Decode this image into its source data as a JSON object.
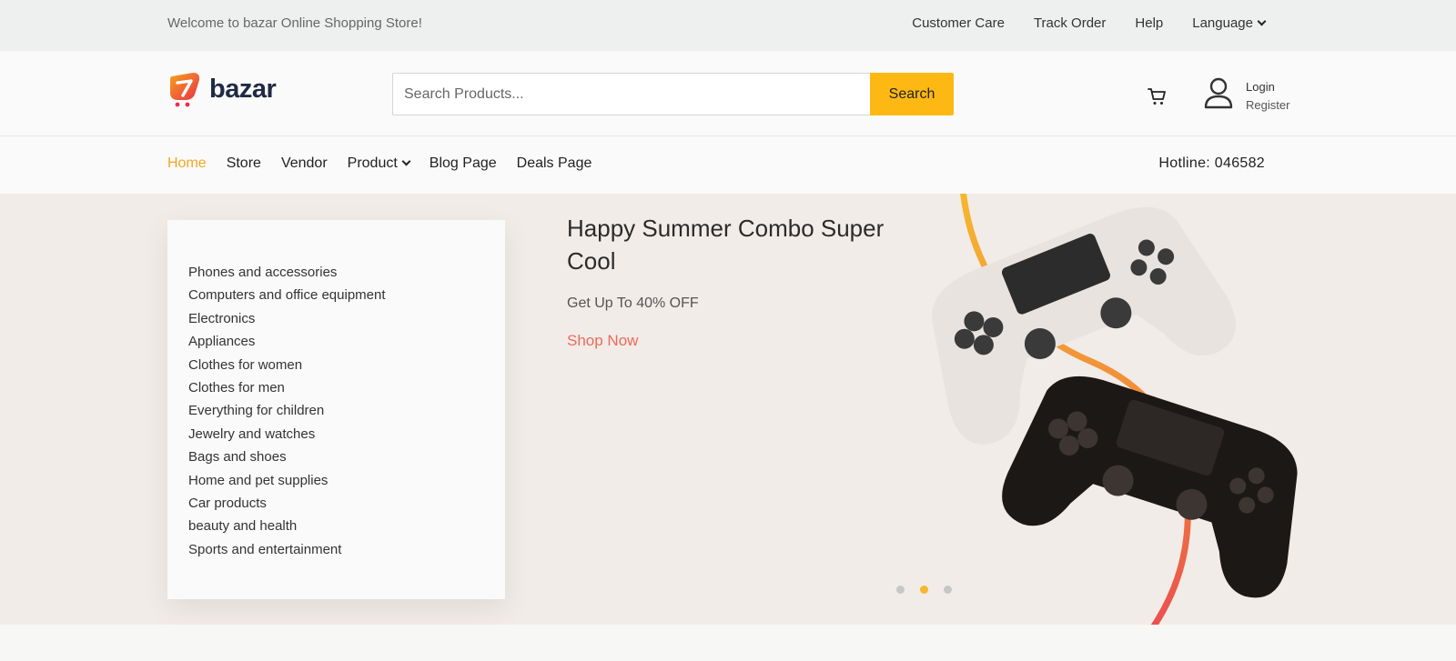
{
  "topbar": {
    "welcome": "Welcome to bazar Online Shopping Store!",
    "links": [
      "Customer Care",
      "Track Order",
      "Help"
    ],
    "language": "Language"
  },
  "header": {
    "logo_text": "bazar",
    "search_placeholder": "Search Products...",
    "search_button": "Search",
    "login": "Login",
    "register": "Register"
  },
  "nav": {
    "items": [
      "Home",
      "Store",
      "Vendor",
      "Product",
      "Blog Page",
      "Deals Page"
    ],
    "active": "Home",
    "hotline": "Hotline: 046582"
  },
  "categories": [
    "Phones and accessories",
    "Computers and office equipment",
    "Electronics",
    "Appliances",
    "Clothes for women",
    "Clothes for men",
    "Everything for children",
    "Jewelry and watches",
    "Bags and shoes",
    "Home and pet supplies",
    "Car products",
    "beauty and health",
    "Sports and entertainment"
  ],
  "hero": {
    "title": "Happy Summer Combo Super Cool",
    "subtitle": "Get Up To 40% OFF",
    "cta": "Shop Now",
    "slides": 3,
    "active_slide": 2
  },
  "colors": {
    "accent": "#fdb813",
    "active_nav": "#f5a623",
    "cta": "#ea6b5c",
    "hero_bg": "#f2ece8"
  }
}
